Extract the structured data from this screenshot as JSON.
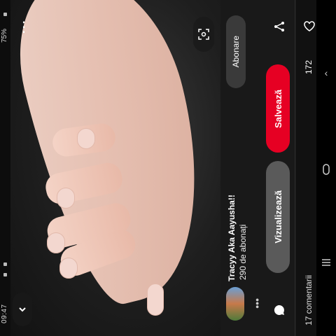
{
  "status_bar": {
    "time": "09:47",
    "battery": "75%"
  },
  "pin": {
    "author_name": "Tracyy Aka Aayusha!!",
    "followers": "290 de abonați",
    "subscribe_label": "Abonare",
    "save_label": "Salvează",
    "view_label": "Vizualizează",
    "like_count": "172",
    "comments": "17 comentarii"
  },
  "icons": {
    "more": "more-vertical-icon",
    "lens": "visual-search-icon",
    "back": "chevron-back-icon",
    "share": "share-icon",
    "like": "heart-icon",
    "chat": "chat-icon",
    "dots": "more-horizontal-icon"
  },
  "colors": {
    "save_button": "#e60023",
    "panel_bg": "#191919",
    "view_button": "#5a5a5a"
  }
}
